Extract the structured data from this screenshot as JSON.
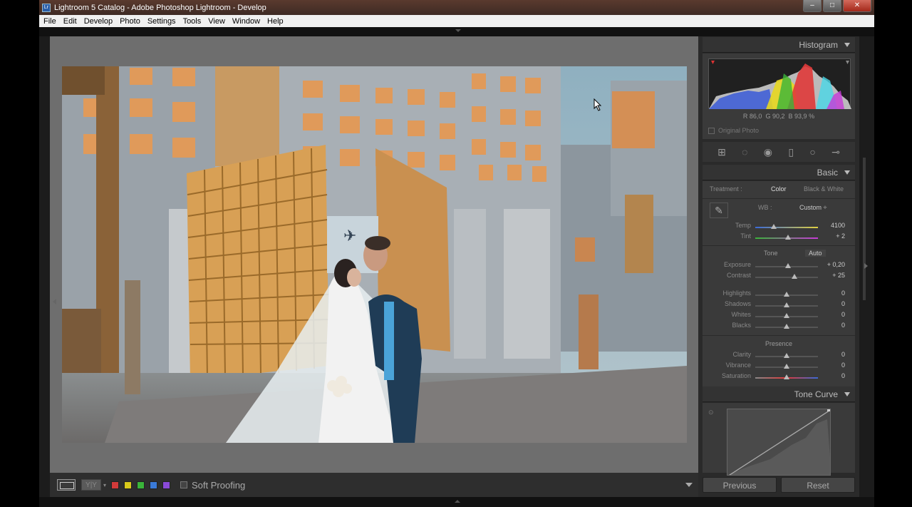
{
  "window": {
    "title": "Lightroom 5 Catalog - Adobe Photoshop Lightroom - Develop",
    "icon_label": "Lr"
  },
  "menu": [
    "File",
    "Edit",
    "Develop",
    "Photo",
    "Settings",
    "Tools",
    "View",
    "Window",
    "Help"
  ],
  "toolbar": {
    "yy_label": "Y|Y",
    "soft_proofing": "Soft Proofing",
    "color_labels": [
      "#d23a3a",
      "#d8c91a",
      "#3ab43a",
      "#3a7ad8",
      "#8a4ad8"
    ]
  },
  "histogram": {
    "title": "Histogram",
    "r_label": "R",
    "r": "86,0",
    "g_label": "G",
    "g": "90,2",
    "b_label": "B",
    "b": "93,9",
    "unit": "%",
    "original_photo": "Original Photo"
  },
  "basic": {
    "title": "Basic",
    "treatment_label": "Treatment :",
    "treatment_color": "Color",
    "treatment_bw": "Black & White",
    "wb_label": "WB :",
    "wb_value": "Custom ÷",
    "temp": {
      "label": "Temp",
      "value": "4100",
      "position": 0.3
    },
    "tint": {
      "label": "Tint",
      "value": "+ 2",
      "position": 0.52
    },
    "tone_label": "Tone",
    "auto_label": "Auto",
    "exposure": {
      "label": "Exposure",
      "value": "+ 0,20",
      "position": 0.52
    },
    "contrast": {
      "label": "Contrast",
      "value": "+ 25",
      "position": 0.62
    },
    "highlights": {
      "label": "Highlights",
      "value": "0",
      "position": 0.5
    },
    "shadows": {
      "label": "Shadows",
      "value": "0",
      "position": 0.5
    },
    "whites": {
      "label": "Whites",
      "value": "0",
      "position": 0.5
    },
    "blacks": {
      "label": "Blacks",
      "value": "0",
      "position": 0.5
    },
    "presence_label": "Presence",
    "clarity": {
      "label": "Clarity",
      "value": "0",
      "position": 0.5
    },
    "vibrance": {
      "label": "Vibrance",
      "value": "0",
      "position": 0.5
    },
    "saturation": {
      "label": "Saturation",
      "value": "0",
      "position": 0.5
    }
  },
  "tone_curve": {
    "title": "Tone Curve"
  },
  "buttons": {
    "previous": "Previous",
    "reset": "Reset"
  }
}
